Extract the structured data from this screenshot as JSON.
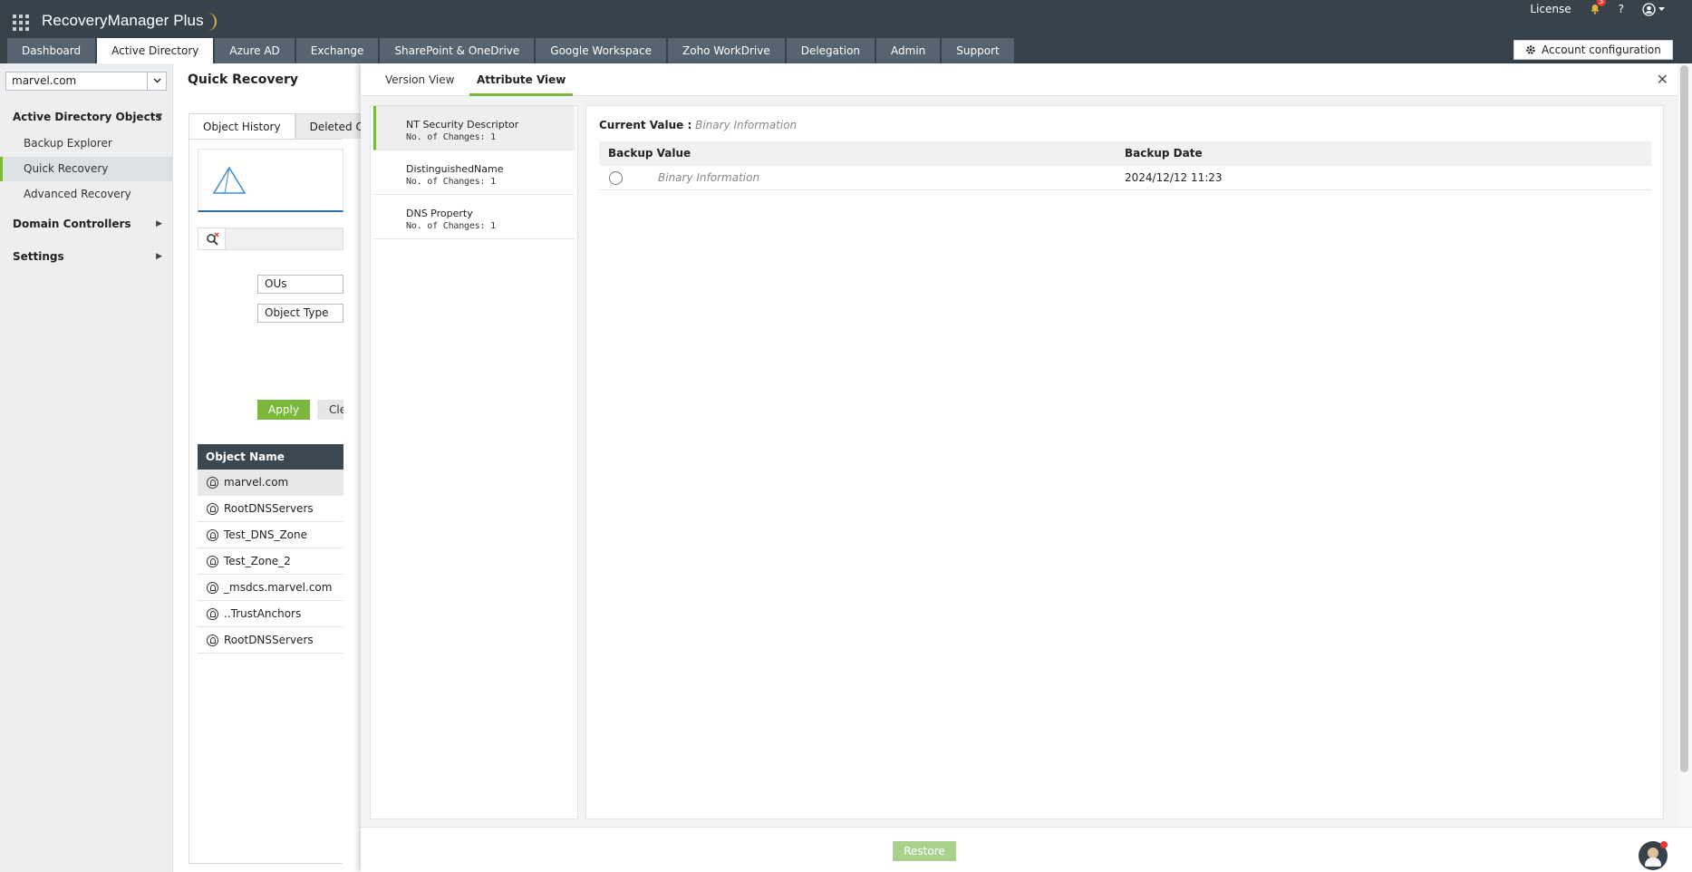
{
  "header": {
    "brand": "RecoveryManager Plus",
    "license": "License",
    "notification_count": "3",
    "help": "?"
  },
  "tabs": [
    {
      "label": "Dashboard"
    },
    {
      "label": "Active Directory"
    },
    {
      "label": "Azure AD"
    },
    {
      "label": "Exchange"
    },
    {
      "label": "SharePoint & OneDrive"
    },
    {
      "label": "Google Workspace"
    },
    {
      "label": "Zoho WorkDrive"
    },
    {
      "label": "Delegation"
    },
    {
      "label": "Admin"
    },
    {
      "label": "Support"
    }
  ],
  "account_config": "Account configuration",
  "sidebar": {
    "domain": "marvel.com",
    "groups": {
      "ad_objects": "Active Directory Objects",
      "domain_controllers": "Domain Controllers",
      "settings": "Settings"
    },
    "items": {
      "backup_explorer": "Backup Explorer",
      "quick_recovery": "Quick Recovery",
      "advanced_recovery": "Advanced Recovery"
    }
  },
  "main": {
    "title": "Quick Recovery",
    "tabs": {
      "history": "Object History",
      "deleted": "Deleted Obj"
    },
    "filter": {
      "ous": "OUs",
      "object_type": "Object Type",
      "apply": "Apply",
      "clear": "Clear"
    },
    "table": {
      "header": "Object Name",
      "rows": [
        "marvel.com",
        "RootDNSServers",
        "Test_DNS_Zone",
        "Test_Zone_2",
        "_msdcs.marvel.com",
        "..TrustAnchors",
        "RootDNSServers"
      ]
    }
  },
  "overlay": {
    "tabs": {
      "version": "Version View",
      "attribute": "Attribute View"
    },
    "attributes": [
      {
        "name": "NT Security Descriptor",
        "changes": "No. of Changes: 1"
      },
      {
        "name": "DistinguishedName",
        "changes": "No. of Changes: 1"
      },
      {
        "name": "DNS Property",
        "changes": "No. of Changes: 1"
      }
    ],
    "current_label": "Current Value :",
    "current_value": "Binary Information",
    "columns": {
      "value": "Backup Value",
      "date": "Backup Date"
    },
    "rows": [
      {
        "value": "Binary Information",
        "date": "2024/12/12 11:23"
      }
    ],
    "restore": "Restore",
    "close": "✕"
  }
}
